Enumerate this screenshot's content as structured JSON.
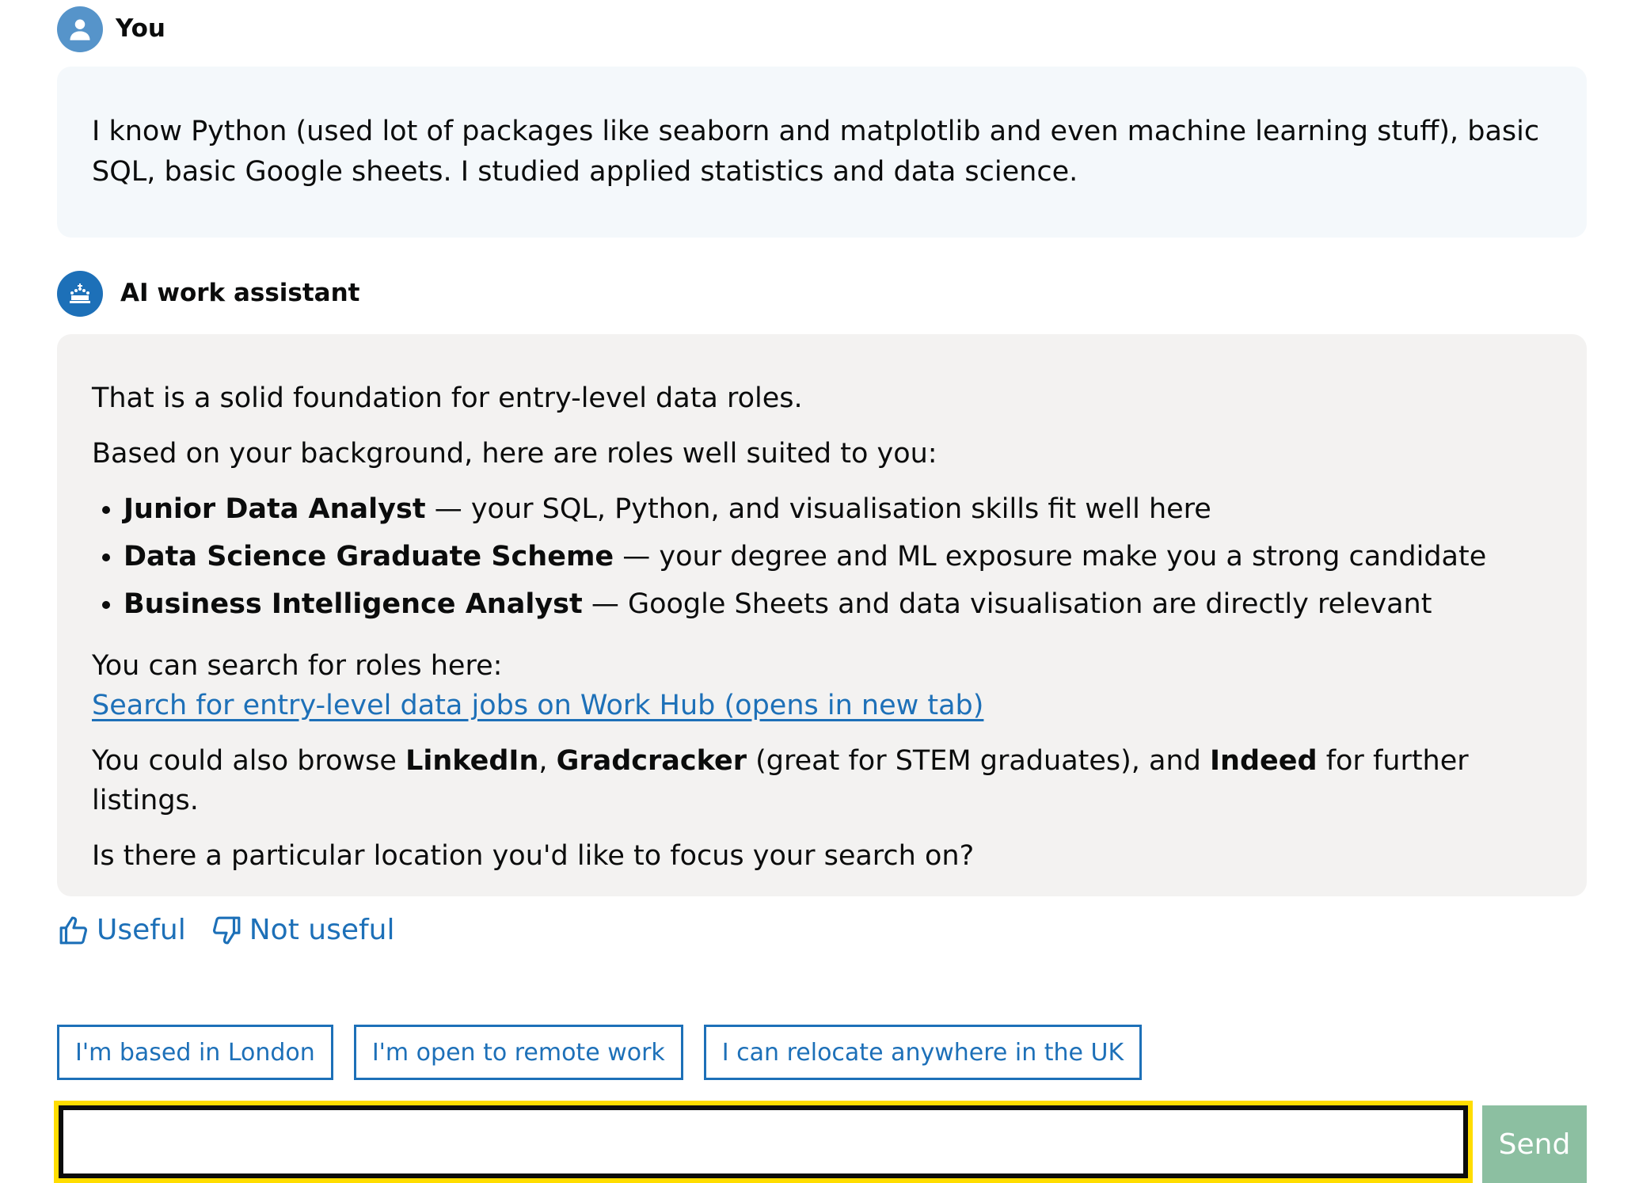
{
  "user": {
    "name": "You",
    "message": "I know Python (used lot of packages like seaborn and matplotlib and even machine learning stuff), basic SQL, basic Google sheets. I studied applied statistics and data science."
  },
  "assistant": {
    "name": "AI work assistant",
    "intro": "That is a solid foundation for entry-level data roles.",
    "lead": "Based on your background, here are roles well suited to you:",
    "roles": [
      {
        "title": "Junior Data Analyst",
        "desc": " — your SQL, Python, and visualisation skills fit well here"
      },
      {
        "title": "Data Science Graduate Scheme",
        "desc": " — your degree and ML exposure make you a strong candidate"
      },
      {
        "title": "Business Intelligence Analyst",
        "desc": " — Google Sheets and data visualisation are directly relevant"
      }
    ],
    "search_intro": "You can search for roles here:",
    "search_link": "Search for entry-level data jobs on Work Hub (opens in new tab)",
    "browse": {
      "prefix": "You could also browse ",
      "site1": "LinkedIn",
      "sep1": ", ",
      "site2": "Gradcracker",
      "mid": " (great for STEM graduates), and ",
      "site3": "Indeed",
      "suffix": " for further listings."
    },
    "question": "Is there a particular location you'd like to focus your search on?"
  },
  "feedback": {
    "useful_label": "Useful",
    "not_useful_label": "Not useful"
  },
  "suggestions": [
    "I'm based in London",
    "I'm open to remote work",
    "I can relocate anywhere in the UK"
  ],
  "composer": {
    "value": "",
    "send_label": "Send"
  },
  "icons": {
    "user_avatar": "person-icon",
    "assistant_avatar": "crown-icon",
    "useful": "thumbs-up-icon",
    "not_useful": "thumbs-down-icon"
  },
  "colors": {
    "link": "#1d70b8",
    "focus": "#ffdd00",
    "send_bg": "#8cbfa1",
    "user_bubble": "#f4f8fb",
    "assistant_bubble": "#f3f2f1"
  }
}
